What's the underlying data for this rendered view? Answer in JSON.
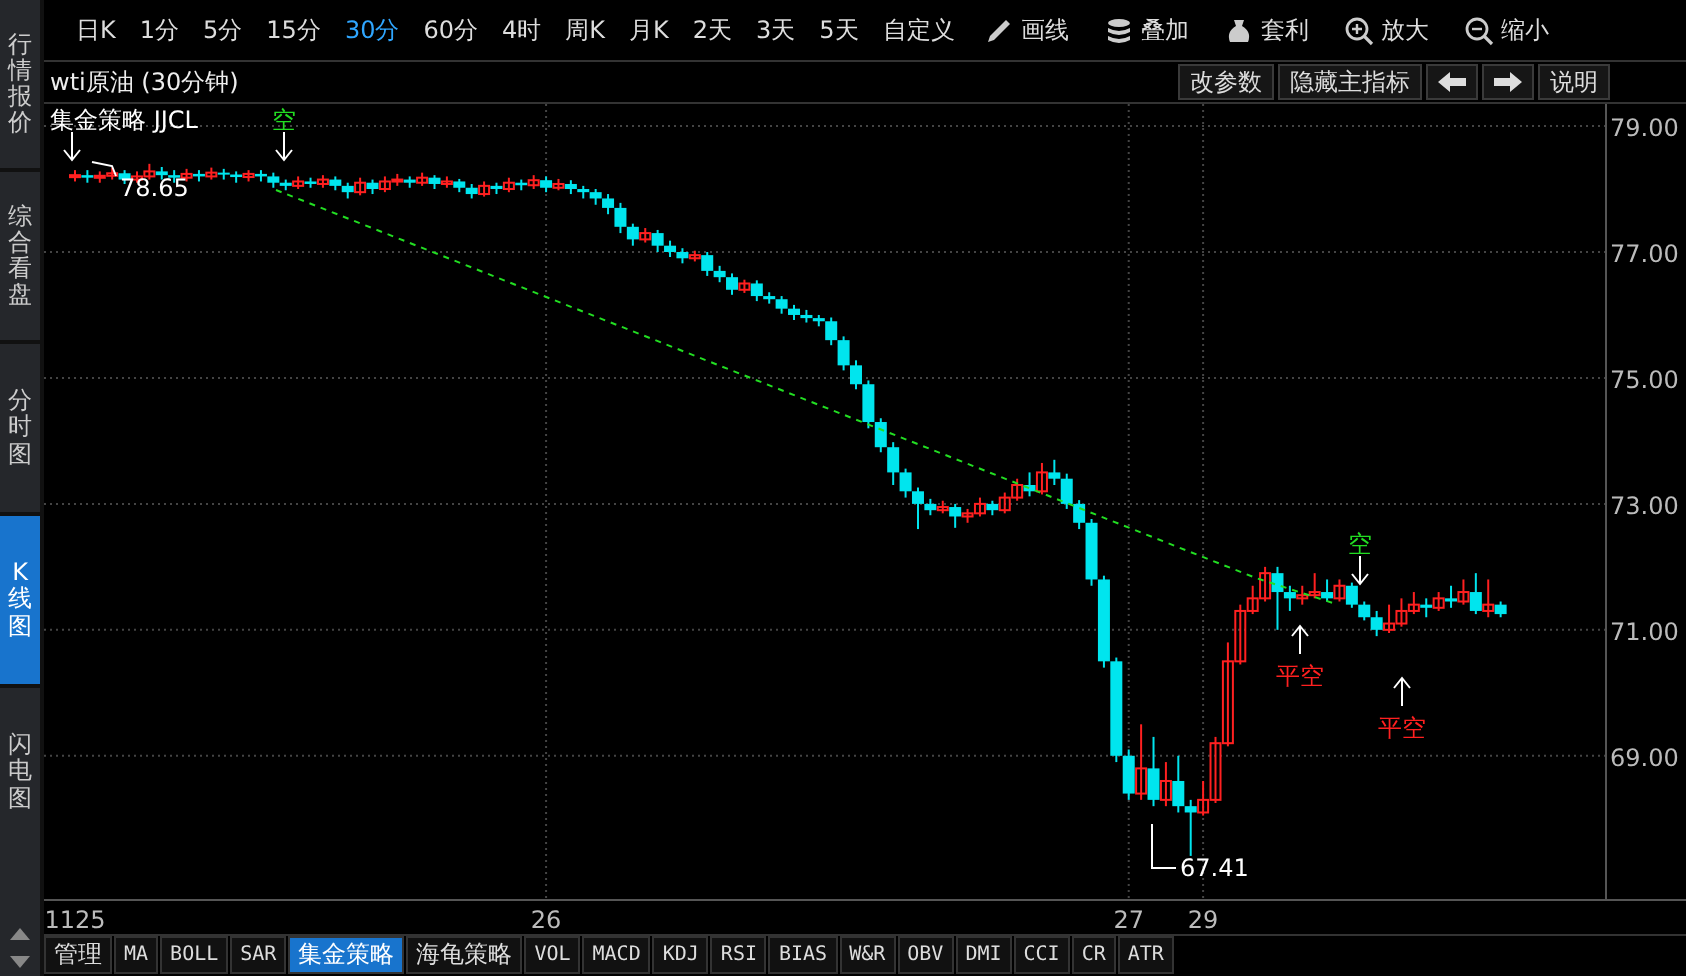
{
  "sidebar": {
    "items": [
      {
        "label": "行情报价",
        "selected": false
      },
      {
        "label": "综合看盘",
        "selected": false
      },
      {
        "label": "分时图",
        "selected": false
      },
      {
        "label": "K线图",
        "selected": true
      },
      {
        "label": "闪电图",
        "selected": false
      }
    ]
  },
  "toolbar": {
    "items": [
      {
        "label": "日K",
        "kind": "period",
        "selected": false
      },
      {
        "label": "1分",
        "kind": "period",
        "selected": false
      },
      {
        "label": "5分",
        "kind": "period",
        "selected": false
      },
      {
        "label": "15分",
        "kind": "period",
        "selected": false
      },
      {
        "label": "30分",
        "kind": "period",
        "selected": true
      },
      {
        "label": "60分",
        "kind": "period",
        "selected": false
      },
      {
        "label": "4时",
        "kind": "period",
        "selected": false
      },
      {
        "label": "周K",
        "kind": "period",
        "selected": false
      },
      {
        "label": "月K",
        "kind": "period",
        "selected": false
      },
      {
        "label": "2天",
        "kind": "period",
        "selected": false
      },
      {
        "label": "3天",
        "kind": "period",
        "selected": false
      },
      {
        "label": "5天",
        "kind": "period",
        "selected": false
      },
      {
        "label": "自定义",
        "kind": "period",
        "selected": false
      },
      {
        "label": "画线",
        "kind": "pencil",
        "selected": false
      },
      {
        "label": "叠加",
        "kind": "stack",
        "selected": false
      },
      {
        "label": "套利",
        "kind": "bag",
        "selected": false
      },
      {
        "label": "放大",
        "kind": "zoomin",
        "selected": false
      },
      {
        "label": "缩小",
        "kind": "zoomout",
        "selected": false
      }
    ]
  },
  "chart_header": {
    "title": "wti原油 (30分钟)",
    "buttons": [
      {
        "kind": "text",
        "label": "改参数"
      },
      {
        "kind": "text",
        "label": "隐藏主指标"
      },
      {
        "kind": "left"
      },
      {
        "kind": "right"
      },
      {
        "kind": "text",
        "label": "说明"
      }
    ]
  },
  "chart": {
    "legend": "集金策略 JJCL",
    "chart_data": {
      "type": "candlestick",
      "ylim": [
        66.71,
        79.35
      ],
      "grid": true,
      "categories": [
        null,
        null,
        "1125",
        null,
        null,
        null,
        null,
        null,
        null,
        null,
        null,
        null,
        null,
        null,
        null,
        null,
        null,
        null,
        null,
        null,
        null,
        null,
        null,
        null,
        null,
        null,
        null,
        null,
        null,
        null,
        null,
        null,
        null,
        null,
        null,
        null,
        null,
        null,
        null,
        null,
        "26",
        null,
        null,
        null,
        null,
        null,
        null,
        null,
        null,
        null,
        null,
        null,
        null,
        null,
        null,
        null,
        null,
        null,
        null,
        null,
        null,
        null,
        null,
        null,
        null,
        null,
        null,
        null,
        null,
        null,
        null,
        null,
        null,
        null,
        null,
        null,
        null,
        null,
        null,
        null,
        null,
        null,
        null,
        null,
        null,
        null,
        null,
        "27",
        null,
        null,
        null,
        null,
        null,
        "29",
        null,
        null,
        null,
        null,
        null,
        null,
        null,
        null,
        null,
        null,
        null,
        null,
        null,
        null,
        null,
        null,
        null,
        null,
        null,
        null,
        null,
        null,
        null,
        null,
        null,
        null,
        null,
        null,
        null,
        null,
        null,
        null
      ],
      "yticks": [
        {
          "value": 79,
          "label": "79.00"
        },
        {
          "value": 77,
          "label": "77.00"
        },
        {
          "value": 75,
          "label": "75.00"
        },
        {
          "value": 73,
          "label": "73.00"
        },
        {
          "value": 71,
          "label": "71.00"
        },
        {
          "value": 69,
          "label": "69.00"
        }
      ],
      "ohlc": [
        null,
        null,
        [
          78.2,
          78.3,
          78.12,
          78.22
        ],
        [
          78.22,
          78.3,
          78.1,
          78.18
        ],
        [
          78.18,
          78.28,
          78.1,
          78.21
        ],
        [
          78.21,
          78.34,
          78.15,
          78.25
        ],
        [
          78.25,
          78.3,
          78.08,
          78.15
        ],
        [
          78.15,
          78.28,
          78.1,
          78.2
        ],
        [
          78.2,
          78.4,
          78.15,
          78.28
        ],
        [
          78.28,
          78.35,
          78.15,
          78.22
        ],
        [
          78.22,
          78.3,
          78.1,
          78.18
        ],
        [
          78.18,
          78.32,
          78.12,
          78.24
        ],
        [
          78.24,
          78.3,
          78.12,
          78.2
        ],
        [
          78.2,
          78.34,
          78.15,
          78.26
        ],
        [
          78.26,
          78.32,
          78.15,
          78.23
        ],
        [
          78.23,
          78.28,
          78.1,
          78.19
        ],
        [
          78.19,
          78.3,
          78.12,
          78.24
        ],
        [
          78.24,
          78.3,
          78.12,
          78.2
        ],
        [
          78.2,
          78.26,
          78.02,
          78.1
        ],
        [
          78.1,
          78.15,
          77.98,
          78.05
        ],
        [
          78.05,
          78.2,
          78.0,
          78.12
        ],
        [
          78.12,
          78.18,
          78.02,
          78.08
        ],
        [
          78.08,
          78.22,
          78.02,
          78.15
        ],
        [
          78.15,
          78.2,
          77.98,
          78.05
        ],
        [
          78.05,
          78.1,
          77.85,
          77.95
        ],
        [
          77.95,
          78.18,
          77.9,
          78.1
        ],
        [
          78.1,
          78.15,
          77.92,
          78.0
        ],
        [
          78.0,
          78.2,
          77.95,
          78.12
        ],
        [
          78.12,
          78.24,
          78.05,
          78.15
        ],
        [
          78.15,
          78.2,
          78.02,
          78.1
        ],
        [
          78.1,
          78.26,
          78.05,
          78.18
        ],
        [
          78.18,
          78.22,
          78.0,
          78.08
        ],
        [
          78.08,
          78.2,
          78.02,
          78.12
        ],
        [
          78.12,
          78.16,
          77.95,
          78.02
        ],
        [
          78.02,
          78.08,
          77.85,
          77.92
        ],
        [
          77.92,
          78.12,
          77.88,
          78.05
        ],
        [
          78.05,
          78.1,
          77.92,
          78.0
        ],
        [
          78.0,
          78.18,
          77.95,
          78.1
        ],
        [
          78.1,
          78.15,
          77.98,
          78.06
        ],
        [
          78.06,
          78.22,
          78.0,
          78.14
        ],
        [
          78.14,
          78.2,
          77.95,
          78.02
        ],
        [
          78.02,
          78.16,
          77.98,
          78.08
        ],
        [
          78.08,
          78.14,
          77.92,
          78.0
        ],
        [
          78.0,
          78.05,
          77.85,
          77.95
        ],
        [
          77.95,
          78.0,
          77.75,
          77.85
        ],
        [
          77.85,
          77.92,
          77.6,
          77.7
        ],
        [
          77.7,
          77.78,
          77.3,
          77.4
        ],
        [
          77.4,
          77.45,
          77.1,
          77.2
        ],
        [
          77.2,
          77.38,
          77.15,
          77.3
        ],
        [
          77.3,
          77.35,
          77.0,
          77.1
        ],
        [
          77.1,
          77.18,
          76.92,
          77.0
        ],
        [
          77.0,
          77.06,
          76.82,
          76.9
        ],
        [
          76.9,
          77.02,
          76.85,
          76.95
        ],
        [
          76.95,
          77.0,
          76.62,
          76.7
        ],
        [
          76.7,
          76.78,
          76.52,
          76.6
        ],
        [
          76.6,
          76.66,
          76.32,
          76.4
        ],
        [
          76.4,
          76.56,
          76.35,
          76.5
        ],
        [
          76.5,
          76.55,
          76.22,
          76.3
        ],
        [
          76.3,
          76.36,
          76.18,
          76.25
        ],
        [
          76.25,
          76.3,
          76.02,
          76.1
        ],
        [
          76.1,
          76.16,
          75.92,
          76.0
        ],
        [
          76.0,
          76.08,
          75.88,
          75.95
        ],
        [
          75.95,
          76.0,
          75.82,
          75.9
        ],
        [
          75.9,
          75.96,
          75.52,
          75.6
        ],
        [
          75.6,
          75.66,
          75.12,
          75.2
        ],
        [
          75.2,
          75.28,
          74.82,
          74.9
        ],
        [
          74.9,
          74.96,
          74.2,
          74.3
        ],
        [
          74.3,
          74.36,
          73.82,
          73.9
        ],
        [
          73.9,
          73.98,
          73.3,
          73.5
        ],
        [
          73.5,
          73.56,
          73.1,
          73.2
        ],
        [
          73.2,
          73.26,
          72.6,
          73.0
        ],
        [
          73.0,
          73.08,
          72.82,
          72.9
        ],
        [
          72.9,
          73.05,
          72.85,
          72.95
        ],
        [
          72.95,
          73.0,
          72.62,
          72.8
        ],
        [
          72.8,
          72.92,
          72.7,
          72.85
        ],
        [
          72.85,
          73.1,
          72.8,
          73.0
        ],
        [
          73.0,
          73.05,
          72.82,
          72.9
        ],
        [
          72.9,
          73.18,
          72.85,
          73.1
        ],
        [
          73.1,
          73.4,
          73.05,
          73.3
        ],
        [
          73.3,
          73.5,
          73.12,
          73.2
        ],
        [
          73.2,
          73.65,
          73.15,
          73.5
        ],
        [
          73.5,
          73.7,
          73.3,
          73.4
        ],
        [
          73.4,
          73.48,
          72.92,
          73.0
        ],
        [
          73.0,
          73.06,
          72.6,
          72.7
        ],
        [
          72.7,
          72.76,
          71.7,
          71.8
        ],
        [
          71.8,
          71.86,
          70.4,
          70.5
        ],
        [
          70.5,
          70.56,
          68.9,
          69.0
        ],
        [
          69.0,
          69.1,
          68.3,
          68.4
        ],
        [
          68.4,
          69.5,
          68.3,
          68.8
        ],
        [
          68.8,
          69.3,
          68.2,
          68.3
        ],
        [
          68.3,
          68.9,
          68.2,
          68.6
        ],
        [
          68.6,
          69.0,
          68.1,
          68.2
        ],
        [
          68.2,
          68.3,
          67.41,
          68.1
        ],
        [
          68.1,
          68.6,
          68.05,
          68.3
        ],
        [
          68.3,
          69.3,
          68.25,
          69.2
        ],
        [
          69.2,
          70.8,
          69.15,
          70.5
        ],
        [
          70.5,
          71.4,
          70.45,
          71.3
        ],
        [
          71.3,
          71.7,
          71.25,
          71.5
        ],
        [
          71.5,
          72.0,
          71.45,
          71.9
        ],
        [
          71.9,
          72.0,
          71.0,
          71.6
        ],
        [
          71.6,
          71.7,
          71.3,
          71.5
        ],
        [
          71.5,
          71.7,
          71.4,
          71.55
        ],
        [
          71.55,
          71.9,
          71.5,
          71.6
        ],
        [
          71.6,
          71.8,
          71.45,
          71.5
        ],
        [
          71.5,
          71.8,
          71.45,
          71.7
        ],
        [
          71.7,
          71.75,
          71.35,
          71.4
        ],
        [
          71.4,
          71.45,
          71.15,
          71.2
        ],
        [
          71.2,
          71.3,
          70.9,
          71.0
        ],
        [
          71.0,
          71.4,
          70.95,
          71.1
        ],
        [
          71.1,
          71.5,
          71.05,
          71.3
        ],
        [
          71.3,
          71.6,
          71.25,
          71.4
        ],
        [
          71.4,
          71.5,
          71.2,
          71.35
        ],
        [
          71.35,
          71.6,
          71.3,
          71.5
        ],
        [
          71.5,
          71.7,
          71.35,
          71.45
        ],
        [
          71.45,
          71.8,
          71.4,
          71.6
        ],
        [
          71.6,
          71.9,
          71.25,
          71.3
        ],
        [
          71.3,
          71.8,
          71.2,
          71.4
        ],
        [
          71.4,
          71.45,
          71.2,
          71.25
        ],
        null,
        null,
        null,
        null,
        null,
        null,
        null,
        null
      ]
    },
    "annotations": [
      {
        "kind": "short"
      },
      {
        "kind": "short",
        "label": "空"
      },
      {
        "kind": "price",
        "label": "78.65"
      },
      {
        "kind": "price",
        "label": "67.41"
      },
      {
        "kind": "short",
        "label": "空"
      },
      {
        "kind": "cover",
        "label": "平空"
      },
      {
        "kind": "cover",
        "label": "平空"
      }
    ]
  },
  "indicator_tabs": [
    {
      "label": "管理",
      "selected": false
    },
    {
      "label": "MA",
      "selected": false
    },
    {
      "label": "BOLL",
      "selected": false
    },
    {
      "label": "SAR",
      "selected": false
    },
    {
      "label": "集金策略",
      "selected": true
    },
    {
      "label": "海龟策略",
      "selected": false
    },
    {
      "label": "VOL",
      "selected": false
    },
    {
      "label": "MACD",
      "selected": false
    },
    {
      "label": "KDJ",
      "selected": false
    },
    {
      "label": "RSI",
      "selected": false
    },
    {
      "label": "BIAS",
      "selected": false
    },
    {
      "label": "W&R",
      "selected": false
    },
    {
      "label": "OBV",
      "selected": false
    },
    {
      "label": "DMI",
      "selected": false
    },
    {
      "label": "CCI",
      "selected": false
    },
    {
      "label": "CR",
      "selected": false
    },
    {
      "label": "ATR",
      "selected": false
    }
  ]
}
